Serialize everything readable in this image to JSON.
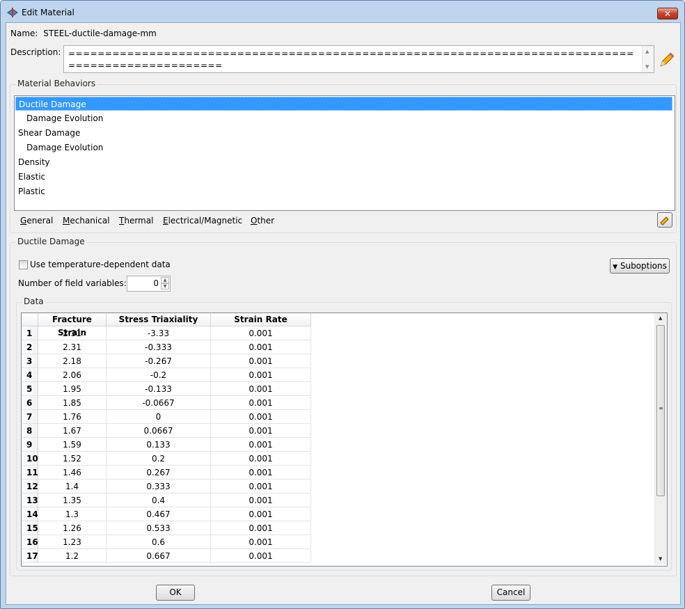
{
  "window": {
    "title": "Edit Material",
    "close_label": "✕"
  },
  "name": {
    "label": "Name:",
    "value": "STEEL-ductile-damage-mm"
  },
  "description": {
    "label": "Description:",
    "value": "=================================================================================================="
  },
  "behaviors": {
    "title": "Material Behaviors",
    "items": [
      {
        "label": "Ductile Damage",
        "selected": true,
        "indent": 0
      },
      {
        "label": "Damage Evolution",
        "selected": false,
        "indent": 1
      },
      {
        "label": "Shear Damage",
        "selected": false,
        "indent": 0
      },
      {
        "label": "Damage Evolution",
        "selected": false,
        "indent": 1
      },
      {
        "label": "Density",
        "selected": false,
        "indent": 0
      },
      {
        "label": "Elastic",
        "selected": false,
        "indent": 0
      },
      {
        "label": "Plastic",
        "selected": false,
        "indent": 0
      }
    ]
  },
  "menu": {
    "items": [
      {
        "mnemonic": "G",
        "rest": "eneral"
      },
      {
        "mnemonic": "M",
        "rest": "echanical"
      },
      {
        "mnemonic": "T",
        "rest": "hermal"
      },
      {
        "mnemonic": "E",
        "rest": "lectrical/Magnetic"
      },
      {
        "mnemonic": "O",
        "rest": "ther"
      }
    ]
  },
  "ductile": {
    "title": "Ductile Damage",
    "temp_label": "Use temperature-dependent data",
    "temp_checked": false,
    "suboptions_label": "Suboptions",
    "field_vars_label": "Number of field variables:",
    "field_vars_value": "0"
  },
  "data_table": {
    "title": "Data",
    "columns": [
      "Fracture Strain",
      "Stress Triaxiality",
      "Strain Rate"
    ],
    "rows": [
      [
        "1",
        "2.31",
        "-3.33",
        "0.001"
      ],
      [
        "2",
        "2.31",
        "-0.333",
        "0.001"
      ],
      [
        "3",
        "2.18",
        "-0.267",
        "0.001"
      ],
      [
        "4",
        "2.06",
        "-0.2",
        "0.001"
      ],
      [
        "5",
        "1.95",
        "-0.133",
        "0.001"
      ],
      [
        "6",
        "1.85",
        "-0.0667",
        "0.001"
      ],
      [
        "7",
        "1.76",
        "0",
        "0.001"
      ],
      [
        "8",
        "1.67",
        "0.0667",
        "0.001"
      ],
      [
        "9",
        "1.59",
        "0.133",
        "0.001"
      ],
      [
        "10",
        "1.52",
        "0.2",
        "0.001"
      ],
      [
        "11",
        "1.46",
        "0.267",
        "0.001"
      ],
      [
        "12",
        "1.4",
        "0.333",
        "0.001"
      ],
      [
        "13",
        "1.35",
        "0.4",
        "0.001"
      ],
      [
        "14",
        "1.3",
        "0.467",
        "0.001"
      ],
      [
        "15",
        "1.26",
        "0.533",
        "0.001"
      ],
      [
        "16",
        "1.23",
        "0.6",
        "0.001"
      ],
      [
        "17",
        "1.2",
        "0.667",
        "0.001"
      ]
    ]
  },
  "buttons": {
    "ok": "OK",
    "cancel": "Cancel"
  },
  "colors": {
    "selection": "#3399ff",
    "frame": "#bfd5ee",
    "client": "#f0f0f0"
  }
}
